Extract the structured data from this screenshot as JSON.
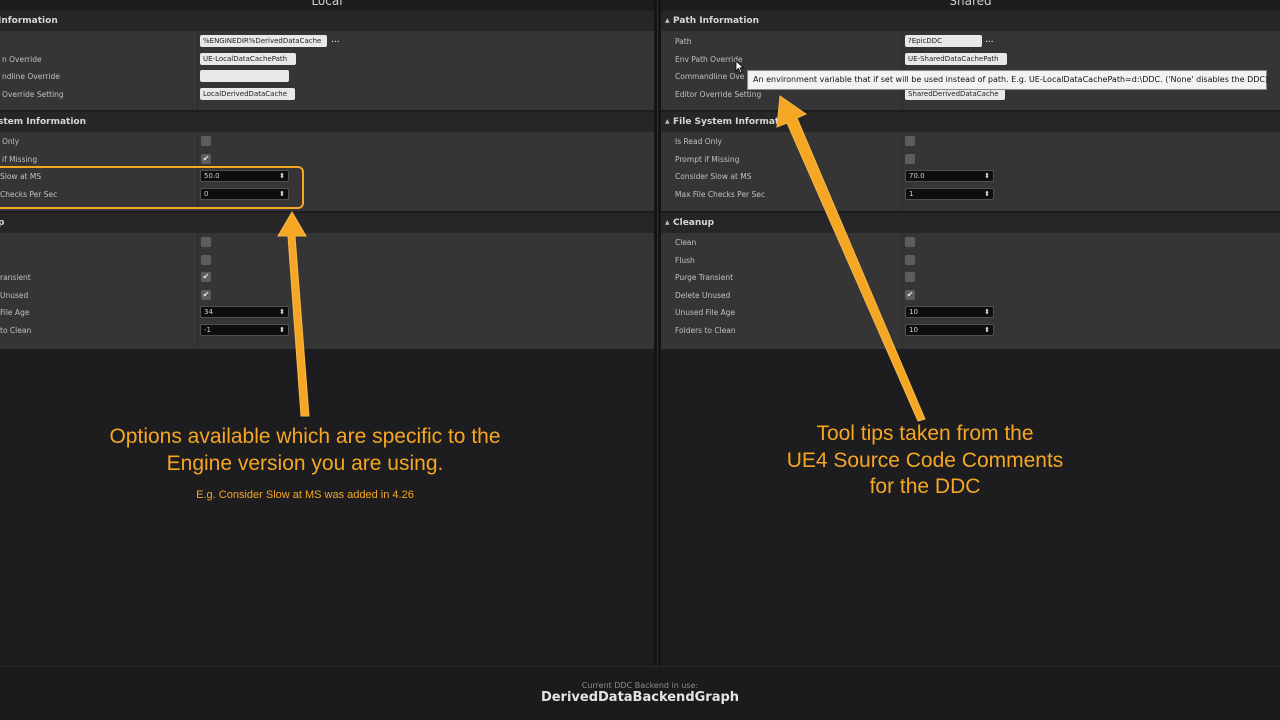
{
  "local": {
    "title": "Local",
    "path_section": {
      "header": "Information",
      "rows": [
        {
          "label": "",
          "value": "%ENGINEDIR%DerivedDataCache",
          "dots": "..."
        },
        {
          "label": "n Override",
          "value": "UE-LocalDataCachePath"
        },
        {
          "label": "ndline Override",
          "value": ""
        },
        {
          "label": "Override Setting",
          "value": "LocalDerivedDataCache"
        }
      ]
    },
    "fs_section": {
      "header": "stem Information",
      "rows": [
        {
          "label": "Only",
          "checked": false
        },
        {
          "label": "if Missing",
          "checked": true
        },
        {
          "label": "Slow at MS",
          "value": "50.0"
        },
        {
          "label": "Checks Per Sec",
          "value": "0"
        }
      ]
    },
    "cleanup_section": {
      "header": "p",
      "rows": [
        {
          "label": "",
          "checked": false
        },
        {
          "label": "",
          "checked": false
        },
        {
          "label": "ransient",
          "checked": true
        },
        {
          "label": "Unused",
          "checked": true
        },
        {
          "label": "File Age",
          "value": "34"
        },
        {
          "label": "to Clean",
          "value": "-1"
        }
      ]
    }
  },
  "shared": {
    "title": "Shared",
    "path_section": {
      "header": "Path Information",
      "rows": [
        {
          "label": "Path",
          "value": "?EpicDDC",
          "dots": "..."
        },
        {
          "label": "Env Path Override",
          "value": "UE-SharedDataCachePath"
        },
        {
          "label": "Commandline Ove",
          "value": ""
        },
        {
          "label": "Editor Override Setting",
          "value": "SharedDerivedDataCache"
        }
      ]
    },
    "fs_section": {
      "header": "File System Information",
      "rows": [
        {
          "label": "Is Read Only",
          "checked": false
        },
        {
          "label": "Prompt if Missing",
          "checked": false
        },
        {
          "label": "Consider Slow at MS",
          "value": "70.0"
        },
        {
          "label": "Max File Checks Per Sec",
          "value": "1"
        }
      ]
    },
    "cleanup_section": {
      "header": "Cleanup",
      "rows": [
        {
          "label": "Clean",
          "checked": false
        },
        {
          "label": "Flush",
          "checked": false
        },
        {
          "label": "Purge Transient",
          "checked": false
        },
        {
          "label": "Delete Unused",
          "checked": true
        },
        {
          "label": "Unused File Age",
          "value": "10"
        },
        {
          "label": "Folders to Clean",
          "value": "10"
        }
      ]
    }
  },
  "tooltip": "An environment variable that if set will be used instead of path. E.g. UE-LocalDataCachePath=d:\\DDC. ('None' disables the DDC)",
  "annotations": {
    "left_line1": "Options available which are specific to the",
    "left_line2": "Engine version you are using.",
    "left_sub": "E.g. Consider Slow at MS was added in 4.26",
    "right_line1": "Tool tips taken from the",
    "right_line2": "UE4 Source Code Comments",
    "right_line3": "for the DDC"
  },
  "footer": {
    "label": "Current DDC Backend in use:",
    "value": "DerivedDataBackendGraph"
  },
  "icons": {
    "section_toggle": "▲",
    "checkmark": "✔",
    "spin": "⬍"
  },
  "colors": {
    "annotation": "#f5a623",
    "panel_bg": "#1d1d1f",
    "section_body": "#353535"
  }
}
